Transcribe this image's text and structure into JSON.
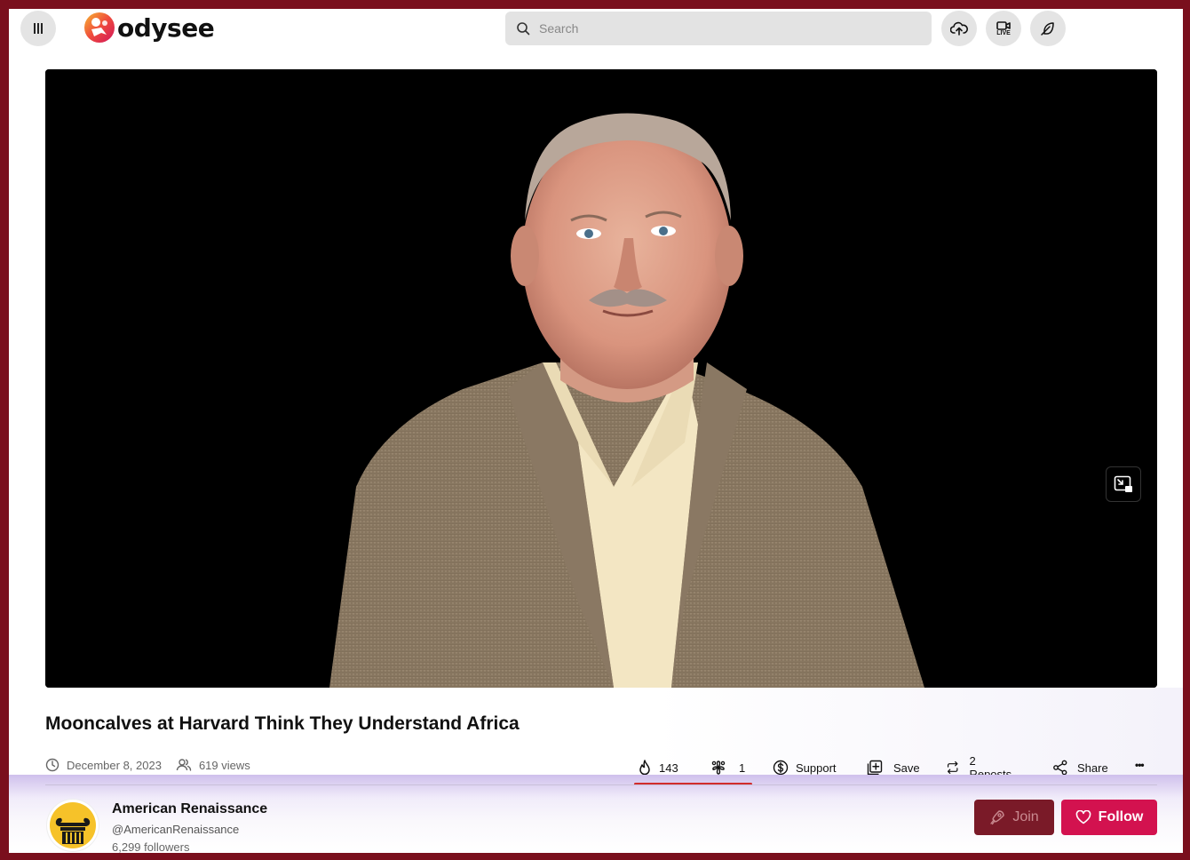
{
  "brand": {
    "name": "odysee"
  },
  "search": {
    "placeholder": "Search"
  },
  "header_buttons": {
    "live_label": "LIVE"
  },
  "video": {
    "title": "Mooncalves at Harvard Think They Understand Africa",
    "date": "December 8, 2023",
    "views": "619 views"
  },
  "actions": {
    "fire_count": "143",
    "slime_count": "1",
    "support_label": "Support",
    "save_label": "Save",
    "reposts_label": "2 Reposts",
    "share_label": "Share",
    "more_label": "•••"
  },
  "channel": {
    "name": "American Renaissance",
    "handle": "@AmericanRenaissance",
    "followers": "6,299 followers",
    "join_label": "Join",
    "follow_label": "Follow"
  },
  "colors": {
    "frame": "#7a0f1d",
    "follow": "#d3124f",
    "join": "#7a1a28",
    "ratio_fire": "#d12c2c"
  }
}
